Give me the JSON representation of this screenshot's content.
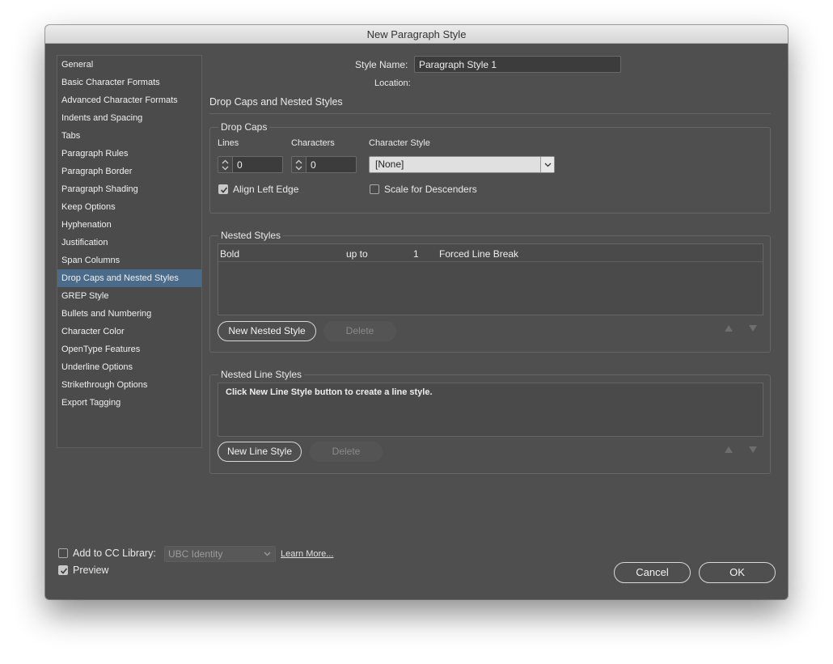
{
  "window": {
    "title": "New Paragraph Style"
  },
  "sidebar": {
    "items": [
      {
        "label": "General",
        "selected": false
      },
      {
        "label": "Basic Character Formats",
        "selected": false
      },
      {
        "label": "Advanced Character Formats",
        "selected": false
      },
      {
        "label": "Indents and Spacing",
        "selected": false
      },
      {
        "label": "Tabs",
        "selected": false
      },
      {
        "label": "Paragraph Rules",
        "selected": false
      },
      {
        "label": "Paragraph Border",
        "selected": false
      },
      {
        "label": "Paragraph Shading",
        "selected": false
      },
      {
        "label": "Keep Options",
        "selected": false
      },
      {
        "label": "Hyphenation",
        "selected": false
      },
      {
        "label": "Justification",
        "selected": false
      },
      {
        "label": "Span Columns",
        "selected": false
      },
      {
        "label": "Drop Caps and Nested Styles",
        "selected": true
      },
      {
        "label": "GREP Style",
        "selected": false
      },
      {
        "label": "Bullets and Numbering",
        "selected": false
      },
      {
        "label": "Character Color",
        "selected": false
      },
      {
        "label": "OpenType Features",
        "selected": false
      },
      {
        "label": "Underline Options",
        "selected": false
      },
      {
        "label": "Strikethrough Options",
        "selected": false
      },
      {
        "label": "Export Tagging",
        "selected": false
      }
    ]
  },
  "header": {
    "style_name_label": "Style Name:",
    "style_name_value": "Paragraph Style 1",
    "location_label": "Location:",
    "section_title": "Drop Caps and Nested Styles"
  },
  "drop_caps": {
    "title": "Drop Caps",
    "lines_label": "Lines",
    "lines_value": "0",
    "characters_label": "Characters",
    "characters_value": "0",
    "char_style_label": "Character Style",
    "char_style_value": "[None]",
    "align_left_edge_label": "Align Left Edge",
    "align_left_edge_checked": true,
    "scale_descenders_label": "Scale for Descenders",
    "scale_descenders_checked": false
  },
  "nested_styles": {
    "title": "Nested Styles",
    "rows": [
      {
        "style": "Bold",
        "relation": "up to",
        "count": "1",
        "delimiter": "Forced Line Break"
      }
    ],
    "new_button": "New Nested Style",
    "delete_button": "Delete"
  },
  "nested_line_styles": {
    "title": "Nested Line Styles",
    "hint": "Click New Line Style button to create a line style.",
    "new_button": "New Line Style",
    "delete_button": "Delete"
  },
  "footer": {
    "cc_label": "Add to CC Library:",
    "cc_checked": false,
    "cc_library": "UBC Identity",
    "learn_more": "Learn More...",
    "preview_label": "Preview",
    "preview_checked": true,
    "cancel": "Cancel",
    "ok": "OK"
  },
  "colors": {
    "dialog_bg": "#4f4f4f",
    "selected_item": "#4a6b8a"
  }
}
